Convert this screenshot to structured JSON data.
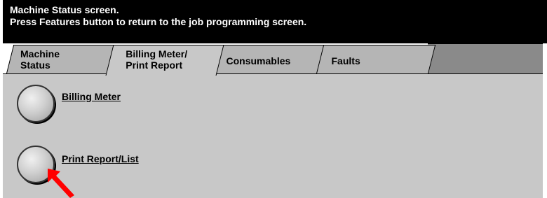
{
  "header": {
    "line1": "Machine Status screen.",
    "line2": "Press Features button to return to the job programming screen."
  },
  "tabs": [
    {
      "line1": "Machine",
      "line2": "Status"
    },
    {
      "line1": "Billing Meter/",
      "line2": "Print Report",
      "active": true
    },
    {
      "label": "Consumables"
    },
    {
      "label": "Faults"
    }
  ],
  "buttons": {
    "billing_meter": "Billing Meter",
    "print_report": "Print Report/List"
  },
  "colors": {
    "header_bg": "#000000",
    "panel_bg": "#c8c8c8",
    "arrow": "#ff0000"
  }
}
